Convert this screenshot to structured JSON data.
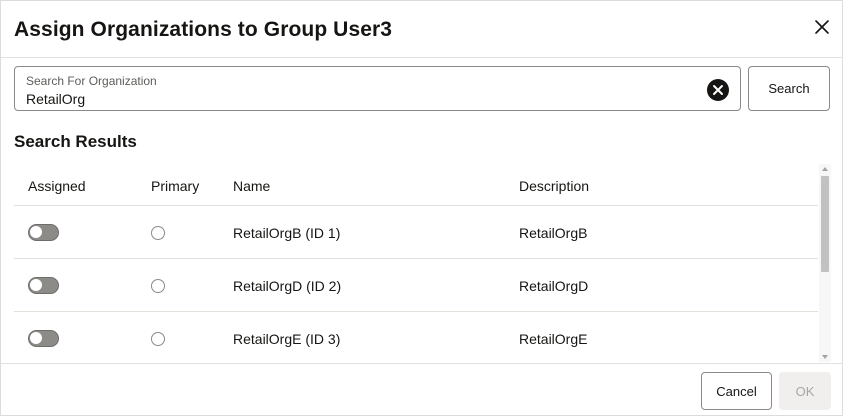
{
  "dialog": {
    "title": "Assign Organizations to Group User3",
    "close_icon": "close-icon"
  },
  "search": {
    "label": "Search For Organization",
    "value": "RetailOrg",
    "clear_icon": "clear-circle-icon",
    "button_label": "Search"
  },
  "results": {
    "heading": "Search Results",
    "columns": [
      "Assigned",
      "Primary",
      "Name",
      "Description"
    ],
    "rows": [
      {
        "assigned": false,
        "primary": false,
        "name": "RetailOrgB (ID 1)",
        "description": "RetailOrgB"
      },
      {
        "assigned": false,
        "primary": false,
        "name": "RetailOrgD (ID 2)",
        "description": "RetailOrgD"
      },
      {
        "assigned": false,
        "primary": false,
        "name": "RetailOrgE (ID 3)",
        "description": "RetailOrgE"
      }
    ]
  },
  "footer": {
    "cancel_label": "Cancel",
    "ok_label": "OK"
  },
  "colors": {
    "text": "#161513",
    "border": "#8c8a87",
    "divider": "#e4e1dd",
    "toggle_off": "#8d8b88",
    "disabled_bg": "#f1efed",
    "disabled_text": "#a9a7a4"
  }
}
